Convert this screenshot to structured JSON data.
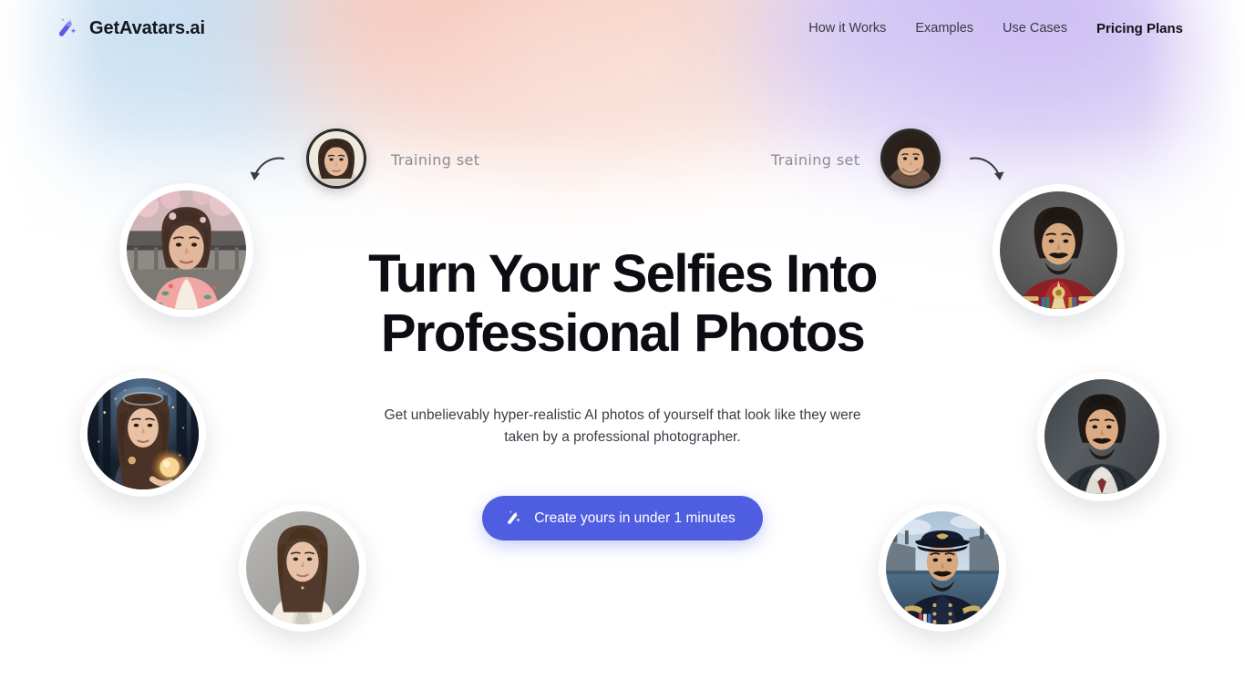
{
  "header": {
    "brand": {
      "name": "GetAvatars.ai",
      "icon": "magic-wand-icon"
    },
    "nav": [
      {
        "label": "How it Works",
        "active": false
      },
      {
        "label": "Examples",
        "active": false
      },
      {
        "label": "Use Cases",
        "active": false
      },
      {
        "label": "Pricing Plans",
        "active": true
      }
    ]
  },
  "hero": {
    "headline_line1": "Turn Your Selfies Into",
    "headline_line2": "Professional Photos",
    "subhead": "Get unbelievably hyper-realistic AI photos of yourself that look like they were taken by a professional photographer.",
    "cta": {
      "label": "Create yours in under 1 minutes",
      "icon": "magic-wand-icon"
    }
  },
  "annotations": {
    "training_set_left": "Training set",
    "training_set_right": "Training set",
    "arrow_left": "curved-arrow-down-left-icon",
    "arrow_right": "curved-arrow-down-right-icon"
  },
  "avatars": [
    {
      "name": "avatar-kimono-woman",
      "alt": "Woman in pink floral kimono outdoors"
    },
    {
      "name": "avatar-fantasy-woman",
      "alt": "Woman holding glowing orb in dark forest"
    },
    {
      "name": "avatar-business-woman",
      "alt": "Woman in white blazer studio headshot"
    },
    {
      "name": "avatar-red-uniform-man",
      "alt": "Man in red ceremonial military uniform"
    },
    {
      "name": "avatar-suited-man",
      "alt": "Man in dark suit and red tie"
    },
    {
      "name": "avatar-naval-officer-man",
      "alt": "Naval officer in cap with ships behind"
    },
    {
      "name": "thumb-selfie-woman",
      "alt": "Plain selfie of a woman, training input"
    },
    {
      "name": "thumb-selfie-man",
      "alt": "Plain selfie of a smiling man, training input"
    }
  ],
  "colors": {
    "accent": "#4f5ee0",
    "headline": "#0c0c12",
    "body_text": "#3c3c47",
    "nav_text": "#3a3a46",
    "label_gray": "#8b8b93",
    "page_bg": "#ffffff",
    "aurora_blue": "#bcd8ef",
    "aurora_peach": "#f6c9bc",
    "aurora_lavender": "#cfc2f4"
  }
}
